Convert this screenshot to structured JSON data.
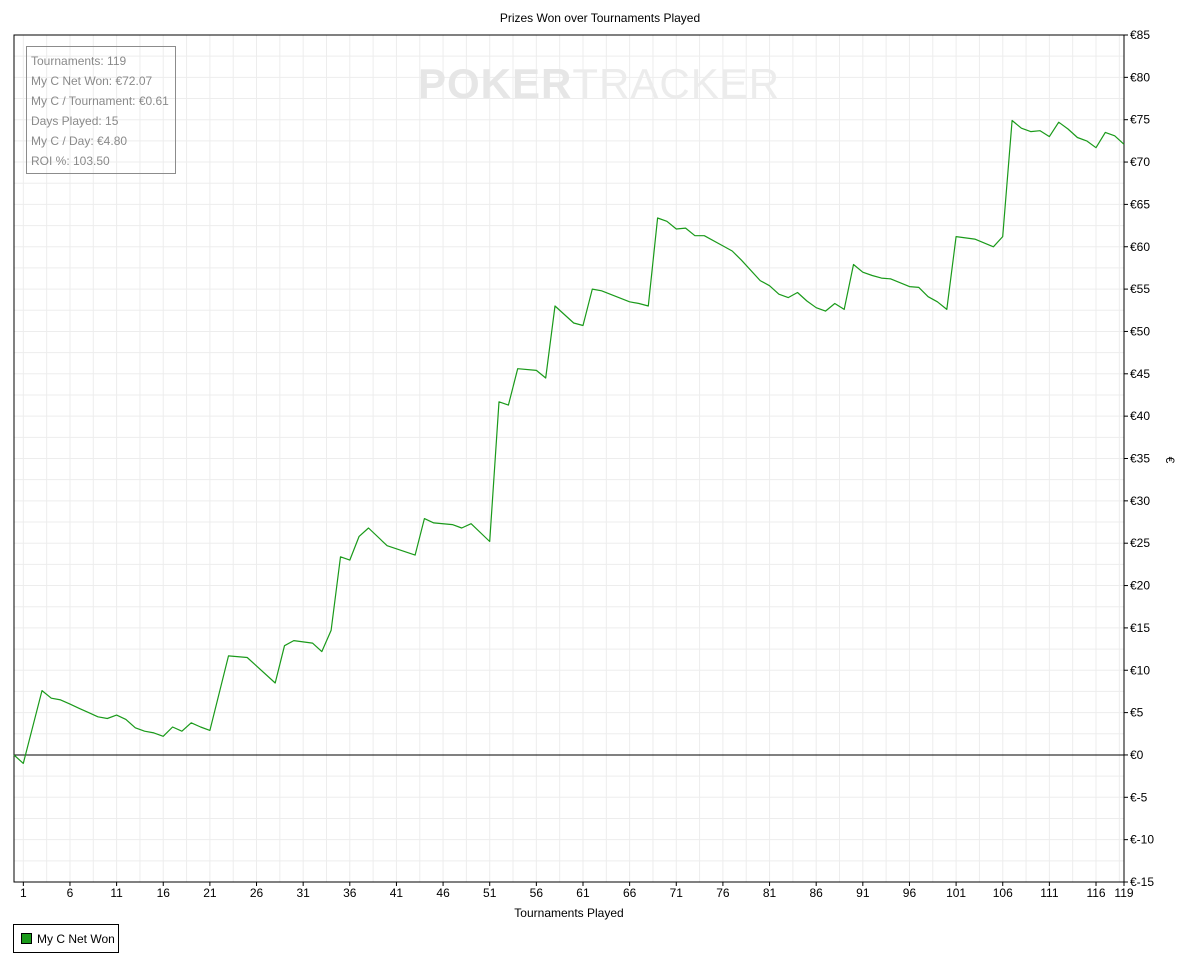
{
  "watermark": {
    "part1": "POKER",
    "part2": "TRACKER"
  },
  "stats": [
    "Tournaments: 119",
    "My C Net Won: €72.07",
    "My C / Tournament: €0.61",
    "Days Played: 15",
    "My C / Day: €4.80",
    "ROI %: 103.50"
  ],
  "legend": {
    "label": "My C Net Won",
    "color": "#1a9a1a"
  },
  "chart_data": {
    "type": "line",
    "title": "Prizes Won over Tournaments Played",
    "xlabel": "Tournaments Played",
    "ylabel": "€",
    "xlim": [
      0,
      119
    ],
    "ylim": [
      -15,
      85
    ],
    "x_ticks": [
      "1",
      "6",
      "11",
      "16",
      "21",
      "26",
      "31",
      "36",
      "41",
      "46",
      "51",
      "56",
      "61",
      "66",
      "71",
      "76",
      "81",
      "86",
      "91",
      "96",
      "101",
      "106",
      "111",
      "116",
      "119"
    ],
    "y_ticks": [
      "€85",
      "€80",
      "€75",
      "€70",
      "€65",
      "€60",
      "€55",
      "€50",
      "€45",
      "€40",
      "€35",
      "€30",
      "€25",
      "€20",
      "€15",
      "€10",
      "€5",
      "€0",
      "€-5",
      "€-10",
      "€-15"
    ],
    "grid": true,
    "legend_position": "bottom-left",
    "series": [
      {
        "name": "My C Net Won",
        "color": "#1a9a1a",
        "x": [
          0,
          1,
          3,
          4,
          5,
          6,
          7,
          8,
          9,
          10,
          11,
          12,
          13,
          14,
          15,
          16,
          17,
          18,
          19,
          20,
          21,
          23,
          25,
          28,
          29,
          30,
          32,
          33,
          34,
          35,
          36,
          37,
          38,
          40,
          43,
          44,
          45,
          47,
          48,
          49,
          51,
          52,
          53,
          54,
          56,
          57,
          58,
          60,
          61,
          62,
          63,
          66,
          67,
          68,
          69,
          70,
          71,
          72,
          73,
          74,
          76,
          77,
          78,
          80,
          81,
          82,
          83,
          84,
          85,
          86,
          87,
          88,
          89,
          90,
          91,
          92,
          93,
          94,
          96,
          97,
          98,
          99,
          100,
          101,
          103,
          105,
          106,
          107,
          108,
          109,
          110,
          111,
          112,
          113,
          114,
          115,
          116,
          117,
          118,
          119
        ],
        "y": [
          0,
          -1,
          7.6,
          6.7,
          6.5,
          6,
          5.5,
          5,
          4.5,
          4.3,
          4.7,
          4.2,
          3.2,
          2.8,
          2.6,
          2.2,
          3.3,
          2.8,
          3.8,
          3.3,
          2.9,
          11.7,
          11.5,
          8.5,
          12.9,
          13.5,
          13.2,
          12.2,
          14.7,
          23.4,
          23,
          25.8,
          26.8,
          24.7,
          23.6,
          27.9,
          27.4,
          27.2,
          26.8,
          27.3,
          25.2,
          41.7,
          41.3,
          45.6,
          45.4,
          44.5,
          53,
          51,
          50.7,
          55,
          54.8,
          53.5,
          53.3,
          53,
          63.4,
          63,
          62.1,
          62.2,
          61.3,
          61.3,
          60.1,
          59.5,
          58.4,
          56,
          55.4,
          54.4,
          54,
          54.6,
          53.6,
          52.8,
          52.4,
          53.3,
          52.6,
          57.9,
          57,
          56.6,
          56.3,
          56.2,
          55.3,
          55.2,
          54.1,
          53.5,
          52.6,
          61.2,
          60.9,
          60,
          61.2,
          74.9,
          74,
          73.6,
          73.7,
          73,
          74.7,
          73.9,
          72.9,
          72.5,
          71.7,
          73.5,
          73.1,
          72.1
        ]
      }
    ]
  }
}
